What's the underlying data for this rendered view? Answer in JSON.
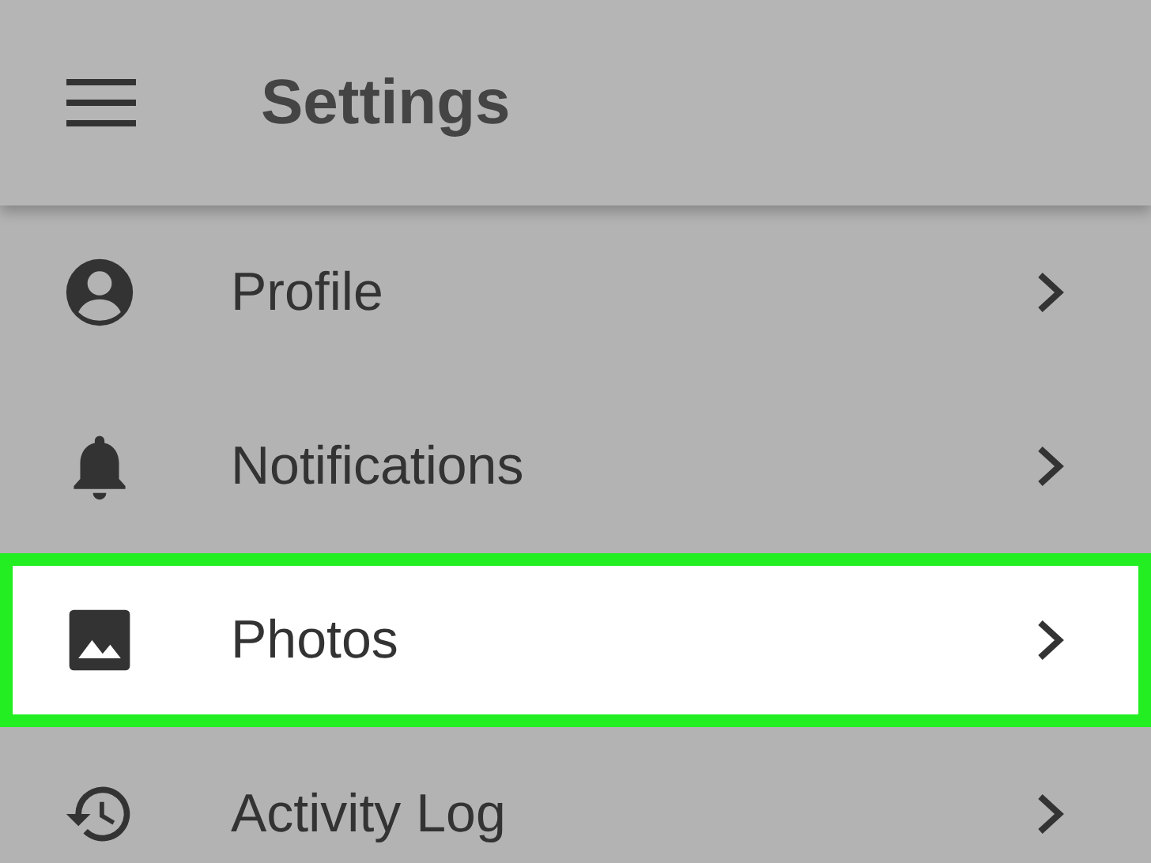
{
  "app_bar": {
    "title": "Settings"
  },
  "items": [
    {
      "label": "Profile",
      "selected": false
    },
    {
      "label": "Notifications",
      "selected": false
    },
    {
      "label": "Photos",
      "selected": true
    },
    {
      "label": "Activity Log",
      "selected": false
    }
  ]
}
